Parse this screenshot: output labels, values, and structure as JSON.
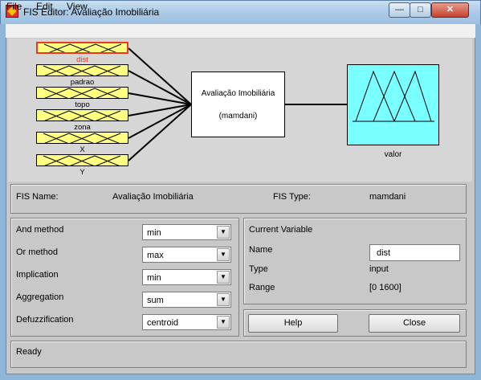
{
  "window": {
    "title": "FIS Editor: Avaliação Imobiliária",
    "min_glyph": "—",
    "max_glyph": "□",
    "close_glyph": "✕"
  },
  "menu": {
    "file": "File",
    "edit": "Edit",
    "view": "View"
  },
  "diagram": {
    "inputs": [
      "dist",
      "padrao",
      "topo",
      "zona",
      "X",
      "Y"
    ],
    "system_name": "Avaliação Imobiliária",
    "system_type": "(mamdani)",
    "output": "valor"
  },
  "info": {
    "fis_name_label": "FIS Name:",
    "fis_name_value": "Avaliação Imobiliária",
    "fis_type_label": "FIS Type:",
    "fis_type_value": "mamdani"
  },
  "methods": {
    "and_label": "And method",
    "and_value": "min",
    "or_label": "Or method",
    "or_value": "max",
    "implication_label": "Implication",
    "implication_value": "min",
    "aggregation_label": "Aggregation",
    "aggregation_value": "sum",
    "defuzz_label": "Defuzzification",
    "defuzz_value": "centroid"
  },
  "current_variable": {
    "heading": "Current Variable",
    "name_label": "Name",
    "name_value": "dist",
    "type_label": "Type",
    "type_value": "input",
    "range_label": "Range",
    "range_value": "[0 1600]"
  },
  "buttons": {
    "help": "Help",
    "close": "Close"
  },
  "status": "Ready",
  "colors": {
    "input_fill": "#ffff80",
    "selected_border": "#e23b2b",
    "output_fill": "#79ffff"
  }
}
